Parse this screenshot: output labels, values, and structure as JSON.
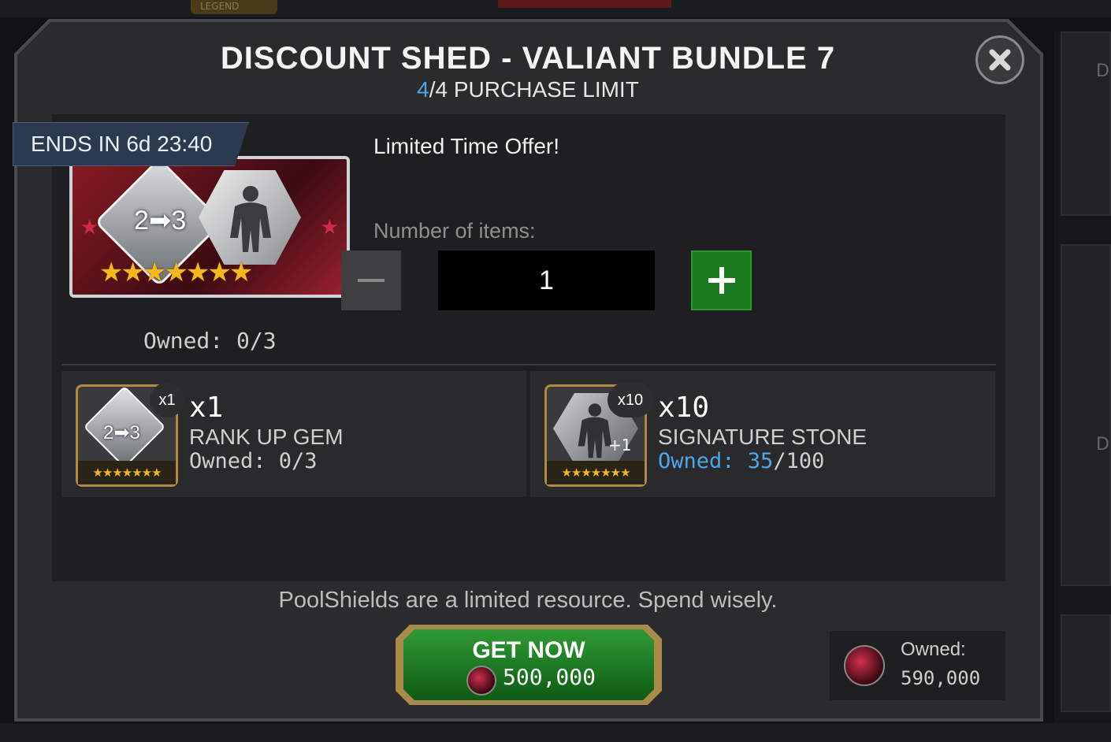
{
  "background": {
    "legend_label": "LEGEND",
    "side_letters": [
      "D",
      "D"
    ]
  },
  "dialog": {
    "title": "DISCOUNT SHED - VALIANT BUNDLE 7",
    "purchase_limit": {
      "current": "4",
      "separator": "/",
      "rest": "4 PURCHASE LIMIT"
    },
    "close_icon": "close-x-icon",
    "ends_in": "ENDS IN 6d 23:40",
    "bundle_art": {
      "rank_text": "2➡3",
      "stars": "★★★★★★★"
    },
    "owned": "Owned: 0/3",
    "offer_text": "Limited Time Offer!",
    "number_label": "Number of items:",
    "quantity_value": "1"
  },
  "items": [
    {
      "badge": "x1",
      "count": "x1",
      "name": "RANK UP GEM",
      "owned": "Owned: 0/3",
      "thumb_text": "2➡3",
      "stars": "★★★★★★★"
    },
    {
      "badge": "x10",
      "count": "x10",
      "name": "SIGNATURE STONE",
      "owned_label": "Owned: 35",
      "owned_total": "/100",
      "thumb_plus": "+1",
      "stars": "★★★★★★★"
    }
  ],
  "footer": {
    "warning": "PoolShields are a limited resource. Spend wisely.",
    "get_now_label": "GET NOW",
    "price": "500,000",
    "wallet_label": "Owned:",
    "wallet_value": "590,000"
  },
  "colors": {
    "accent_blue": "#4aa8e8",
    "button_green": "#1a7a1e",
    "gold": "#f2b81e"
  }
}
